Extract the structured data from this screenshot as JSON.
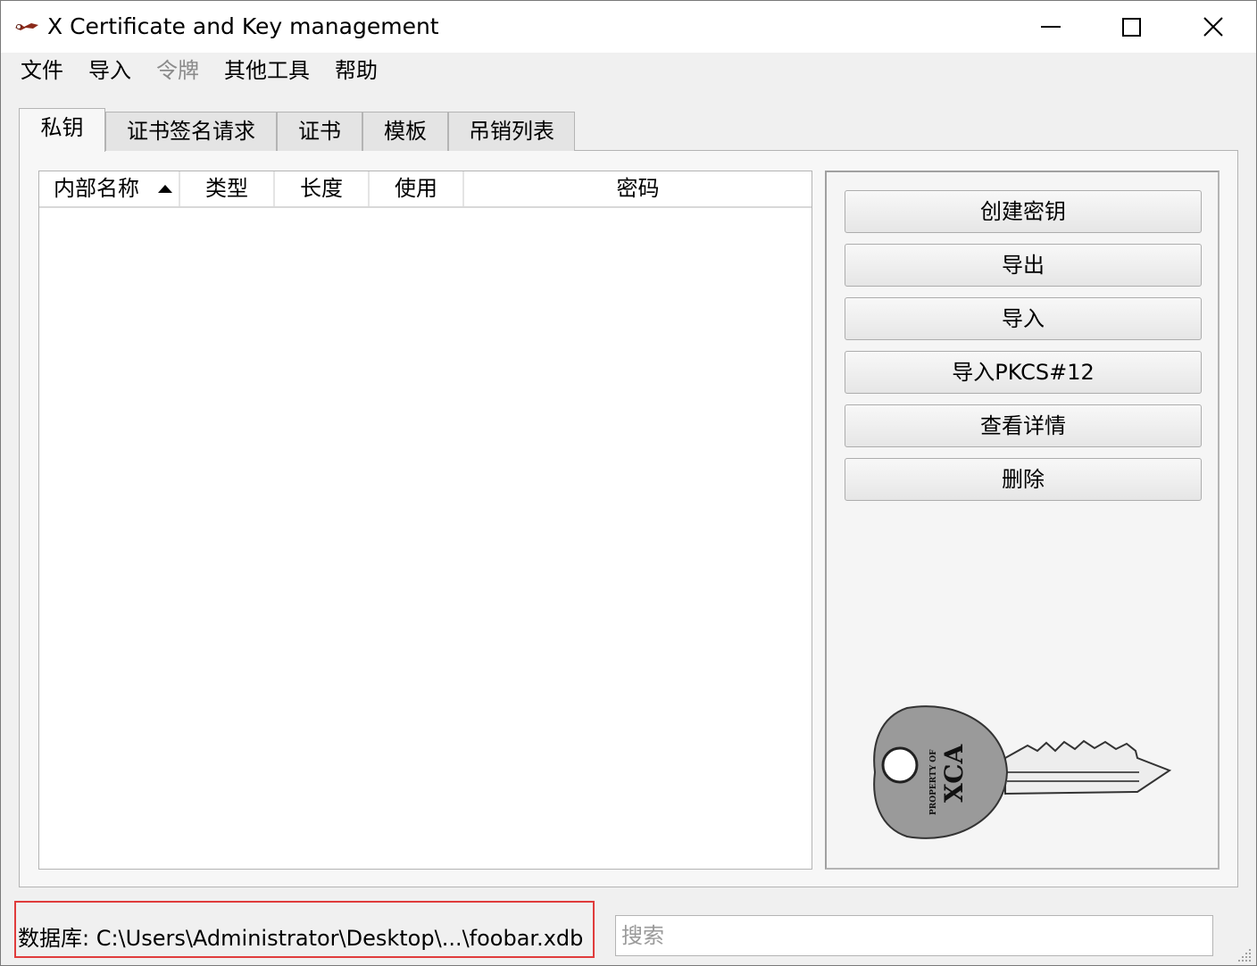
{
  "window": {
    "title": "X Certificate and Key management"
  },
  "menu": {
    "items": [
      "文件",
      "导入",
      "令牌",
      "其他工具",
      "帮助"
    ],
    "disabled": [
      2
    ]
  },
  "tabs": [
    "私钥",
    "证书签名请求",
    "证书",
    "模板",
    "吊销列表"
  ],
  "active_tab": 0,
  "table": {
    "columns": [
      "内部名称",
      "类型",
      "长度",
      "使用",
      "密码"
    ],
    "sorted_column": 0,
    "sort_order": "ascending",
    "rows": []
  },
  "actions": [
    "创建密钥",
    "导出",
    "导入",
    "导入PKCS#12",
    "查看详情",
    "删除"
  ],
  "key_image": {
    "text_small": "PROPERTY OF",
    "text_large": "XCA"
  },
  "status": {
    "database_label": "数据库: C:\\Users\\Administrator\\Desktop\\...\\foobar.xdb"
  },
  "search": {
    "placeholder": "搜索",
    "value": ""
  }
}
